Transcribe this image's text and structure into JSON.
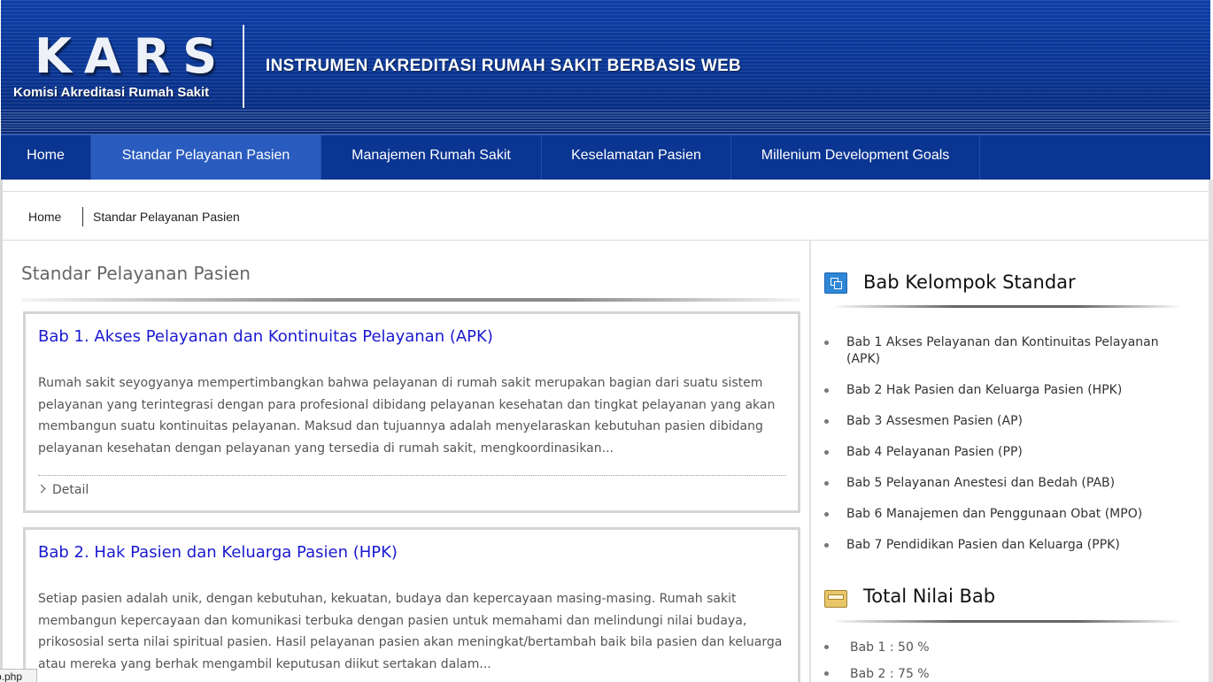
{
  "header": {
    "logo_text": "KARS",
    "logo_subtitle": "Komisi Akreditasi Rumah Sakit",
    "title": "INSTRUMEN AKREDITASI RUMAH SAKIT BERBASIS WEB"
  },
  "nav": {
    "items": [
      {
        "label": "Home"
      },
      {
        "label": "Standar Pelayanan Pasien"
      },
      {
        "label": "Manajemen Rumah Sakit"
      },
      {
        "label": "Keselamatan Pasien"
      },
      {
        "label": "Millenium Development Goals"
      }
    ],
    "active_index": 1
  },
  "breadcrumb": {
    "home": "Home",
    "current": "Standar Pelayanan Pasien"
  },
  "main": {
    "title": "Standar Pelayanan Pasien",
    "cards": [
      {
        "title": "Bab 1. Akses Pelayanan dan Kontinuitas Pelayanan (APK)",
        "body": "Rumah sakit seyogyanya mempertimbangkan bahwa pelayanan di rumah sakit merupakan bagian dari suatu sistem pelayanan yang terintegrasi dengan para profesional dibidang pelayanan kesehatan dan tingkat pelayanan yang akan membangun suatu kontinuitas pelayanan. Maksud dan tujuannya adalah menyelaraskan kebutuhan pasien dibidang pelayanan kesehatan dengan pelayanan yang tersedia di rumah sakit, mengkoordinasikan...",
        "detail_label": "Detail"
      },
      {
        "title": "Bab 2. Hak Pasien dan Keluarga Pasien (HPK)",
        "body": "Setiap pasien adalah unik, dengan kebutuhan, kekuatan, budaya dan kepercayaan masing-masing. Rumah sakit membangun kepercayaan dan komunikasi terbuka dengan pasien untuk memahami dan melindungi nilai budaya, prikososial serta nilai spiritual pasien. Hasil pelayanan pasien akan meningkat/bertambah baik bila pasien dan keluarga atau mereka yang berhak mengambil keputusan diikut sertakan dalam..."
      }
    ]
  },
  "sidebar": {
    "bab_heading": "Bab Kelompok Standar",
    "bab_icon": "windows-icon",
    "bab_items": [
      "Bab 1 Akses Pelayanan dan Kontinuitas Pelayanan (APK)",
      "Bab 2 Hak Pasien dan Keluarga Pasien (HPK)",
      "Bab 3 Assesmen Pasien (AP)",
      "Bab 4 Pelayanan Pasien (PP)",
      "Bab 5 Pelayanan Anestesi dan Bedah (PAB)",
      "Bab 6 Manajemen dan Penggunaan Obat (MPO)",
      "Bab 7 Pendidikan Pasien dan Keluarga (PPK)"
    ],
    "total_heading": "Total Nilai Bab",
    "total_icon": "folder-icon",
    "total_items": [
      "Bab 1 : 50 %",
      "Bab 2 : 75 %"
    ]
  },
  "statusbar": {
    "text": "p.php"
  },
  "colors": {
    "header_blue": "#0a3490",
    "nav_active": "#2a5bbf",
    "link_blue": "#1a1ad0"
  }
}
